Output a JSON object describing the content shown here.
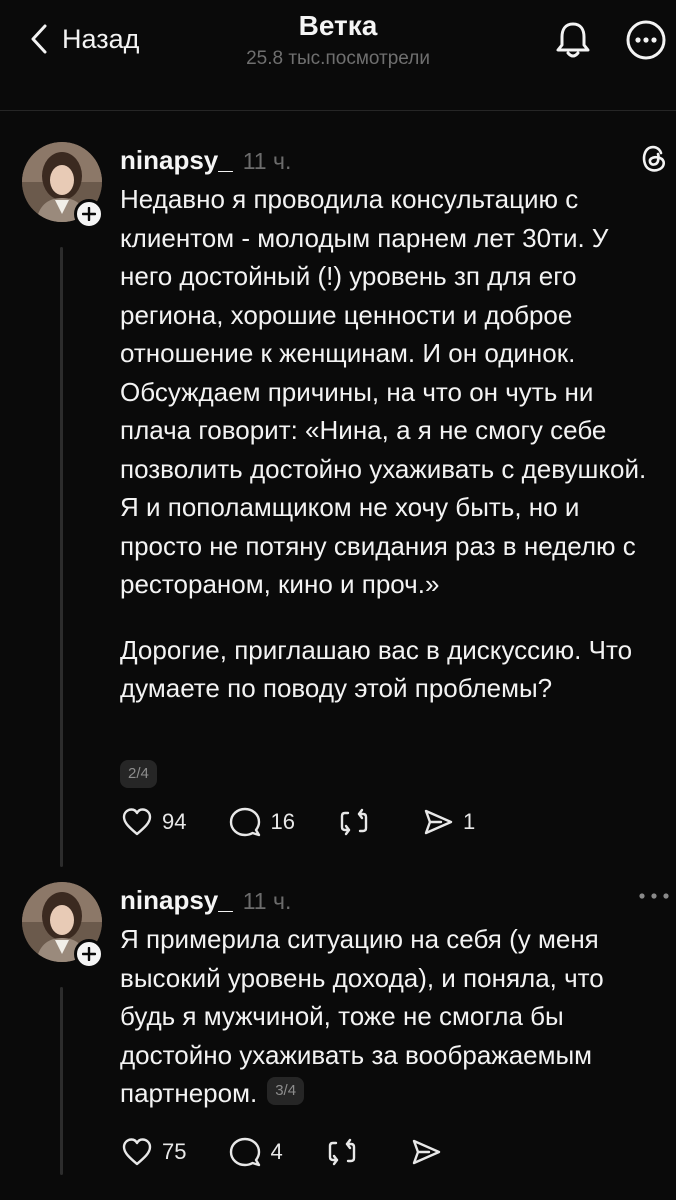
{
  "header": {
    "back_label": "Назад",
    "title": "Ветка",
    "views": "25.8 тыс.посмотрели"
  },
  "posts": [
    {
      "username": "ninapsy_",
      "time": "11 ч.",
      "paragraphs": [
        "Недавно я проводила консультацию с клиентом - молодым парнем лет 30ти. У него достойный (!) уровень зп для его региона, хорошие ценности и доброе отношение к женщинам. И он одинок. Обсуждаем причины, на что он чуть ни плача говорит: «Нина, а я не смогу себе позволить достойно ухаживать с девушкой. Я и пополамщиком не хочу быть, но и просто не потяну свидания раз в неделю с рестораном, кино и проч.»",
        "Дорогие, приглашаю вас в дискуссию. Что думаете по поводу этой проблемы?"
      ],
      "counter": "2/4",
      "likes": "94",
      "replies": "16",
      "reposts": "",
      "shares": "1",
      "corner_icon": "threads-logo-icon"
    },
    {
      "username": "ninapsy_",
      "time": "11 ч.",
      "paragraphs": [
        "Я примерила ситуацию на себя (у меня высокий уровень дохода), и поняла, что будь я мужчиной, тоже не смогла бы достойно ухаживать за воображаемым партнером."
      ],
      "counter": "3/4",
      "likes": "75",
      "replies": "4",
      "reposts": "",
      "shares": "",
      "corner_icon": "more-dots-icon"
    }
  ],
  "colors": {
    "background": "#0a0a0a",
    "text": "#f3f3f3",
    "muted": "#6c6c6c",
    "counter_bg": "#262626"
  }
}
